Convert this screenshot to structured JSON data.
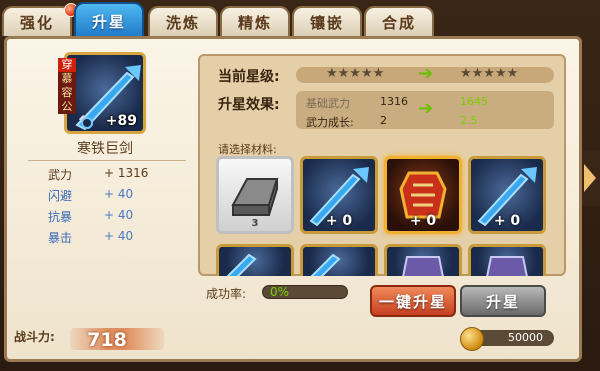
{
  "tabs": [
    {
      "label": "强化",
      "active": false
    },
    {
      "label": "升星",
      "active": true
    },
    {
      "label": "洗炼",
      "active": false
    },
    {
      "label": "精炼",
      "active": false
    },
    {
      "label": "镶嵌",
      "active": false
    },
    {
      "label": "合成",
      "active": false
    }
  ],
  "item": {
    "tag": "穿",
    "owner": "慕容公",
    "level": "+89",
    "name": "寒铁巨剑",
    "stats": [
      {
        "label": "武力",
        "value": "+ 1316"
      },
      {
        "label": "闪避",
        "value": "+ 40"
      },
      {
        "label": "抗暴",
        "value": "+ 40"
      },
      {
        "label": "暴击",
        "value": "+ 40"
      }
    ]
  },
  "power": {
    "label": "战斗力:",
    "value": "718"
  },
  "star_level": {
    "label": "当前星级:",
    "current": "★★★★★",
    "next": "★★★★★"
  },
  "effect": {
    "label": "升星效果:",
    "base_label": "基础武力",
    "base_current": "1316",
    "base_next": "1645",
    "growth_label": "武力成长:",
    "growth_current": "2",
    "growth_next": "2.5"
  },
  "materials": {
    "label": "请选择材料:",
    "slots": [
      {
        "type": "iron",
        "count": "3"
      },
      {
        "type": "sword",
        "count": "+ 0"
      },
      {
        "type": "armor",
        "count": "+ 0"
      },
      {
        "type": "sword",
        "count": "+ 0"
      },
      {
        "type": "sword",
        "count": ""
      },
      {
        "type": "sword",
        "count": ""
      },
      {
        "type": "helm",
        "count": ""
      },
      {
        "type": "helm",
        "count": ""
      }
    ]
  },
  "success": {
    "label": "成功率:",
    "value": "0%"
  },
  "buttons": {
    "one_key": "一键升星",
    "upgrade": "升星"
  },
  "cost": {
    "value": "50000"
  },
  "colors": {
    "accent_blue": "#1f78c8",
    "gold": "#f0b030",
    "green": "#7ad000"
  }
}
